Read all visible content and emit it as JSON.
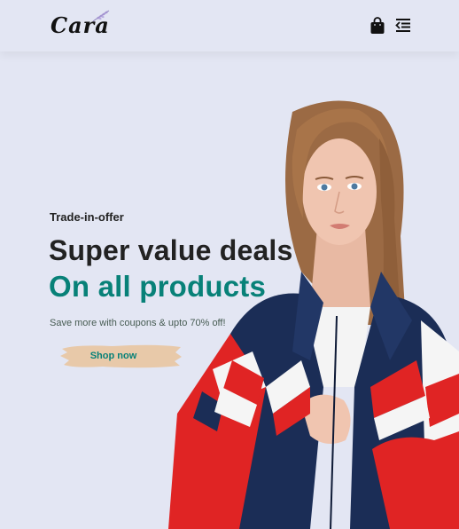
{
  "header": {
    "logo_text": "Cara",
    "icons": {
      "bag": "shopping-bag-icon",
      "menu": "menu-icon"
    }
  },
  "hero": {
    "kicker": "Trade-in-offer",
    "headline": "Super value deals",
    "subheadline": "On all products",
    "description": "Save more with coupons & upto 70% off!",
    "button_label": "Shop now"
  },
  "colors": {
    "background": "#e3e6f3",
    "accent": "#088178",
    "button_bg": "#e8c9a9",
    "text_dark": "#222222",
    "jacket_navy": "#1b2d56",
    "jacket_red": "#e02424"
  }
}
